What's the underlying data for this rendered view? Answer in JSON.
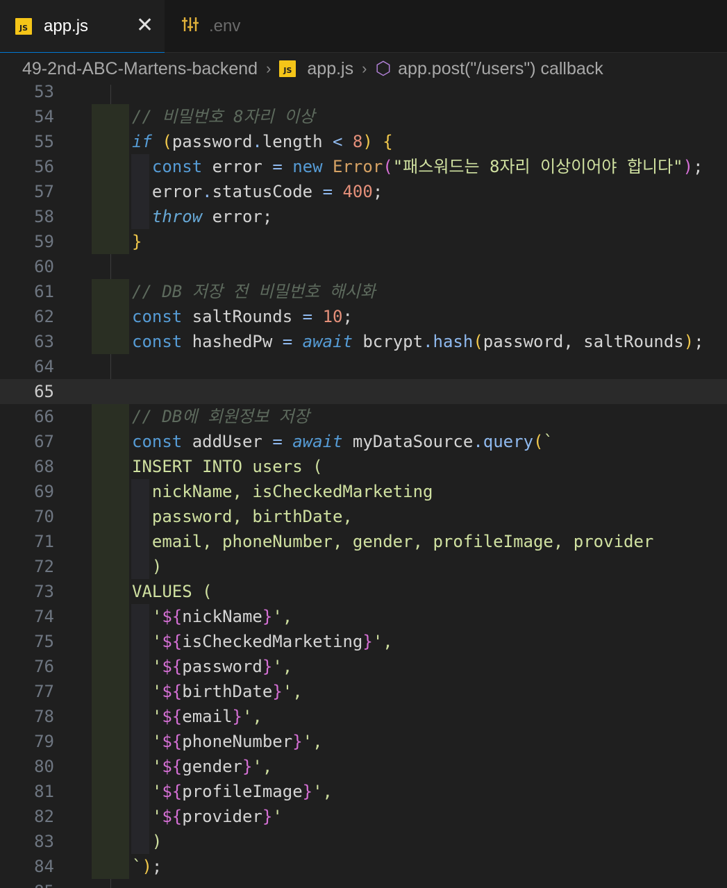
{
  "tabs": [
    {
      "label": "app.js",
      "icon": "js-file-icon",
      "active": true
    },
    {
      "label": ".env",
      "icon": "settings-file-icon",
      "active": false
    }
  ],
  "breadcrumb": {
    "folder": "49-2nd-ABC-Martens-backend",
    "file": "app.js",
    "symbol": "app.post(\"/users\") callback"
  },
  "editor": {
    "current_line": 65,
    "lines": [
      {
        "n": 53,
        "text": ""
      },
      {
        "n": 54,
        "text": "// 비밀번호 8자리 이상"
      },
      {
        "n": 55,
        "text": "if (password.length < 8) {"
      },
      {
        "n": 56,
        "text": "  const error = new Error(\"패스워드는 8자리 이상이어야 합니다\");"
      },
      {
        "n": 57,
        "text": "  error.statusCode = 400;"
      },
      {
        "n": 58,
        "text": "  throw error;"
      },
      {
        "n": 59,
        "text": "}"
      },
      {
        "n": 60,
        "text": ""
      },
      {
        "n": 61,
        "text": "// DB 저장 전 비밀번호 해시화"
      },
      {
        "n": 62,
        "text": "const saltRounds = 10;"
      },
      {
        "n": 63,
        "text": "const hashedPw = await bcrypt.hash(password, saltRounds);"
      },
      {
        "n": 64,
        "text": ""
      },
      {
        "n": 65,
        "text": ""
      },
      {
        "n": 66,
        "text": "// DB에 회원정보 저장"
      },
      {
        "n": 67,
        "text": "const addUser = await myDataSource.query(`"
      },
      {
        "n": 68,
        "text": "INSERT INTO users ("
      },
      {
        "n": 69,
        "text": "  nickName, isCheckedMarketing"
      },
      {
        "n": 70,
        "text": "  password, birthDate,"
      },
      {
        "n": 71,
        "text": "  email, phoneNumber, gender, profileImage, provider"
      },
      {
        "n": 72,
        "text": "  )"
      },
      {
        "n": 73,
        "text": "VALUES ("
      },
      {
        "n": 74,
        "text": "  '${nickName}',"
      },
      {
        "n": 75,
        "text": "  '${isCheckedMarketing}',"
      },
      {
        "n": 76,
        "text": "  '${password}',"
      },
      {
        "n": 77,
        "text": "  '${birthDate}',"
      },
      {
        "n": 78,
        "text": "  '${email}',"
      },
      {
        "n": 79,
        "text": "  '${phoneNumber}',"
      },
      {
        "n": 80,
        "text": "  '${gender}',"
      },
      {
        "n": 81,
        "text": "  '${profileImage}',"
      },
      {
        "n": 82,
        "text": "  '${provider}'"
      },
      {
        "n": 83,
        "text": "  )"
      },
      {
        "n": 84,
        "text": "`);"
      },
      {
        "n": 85,
        "text": ""
      }
    ]
  }
}
